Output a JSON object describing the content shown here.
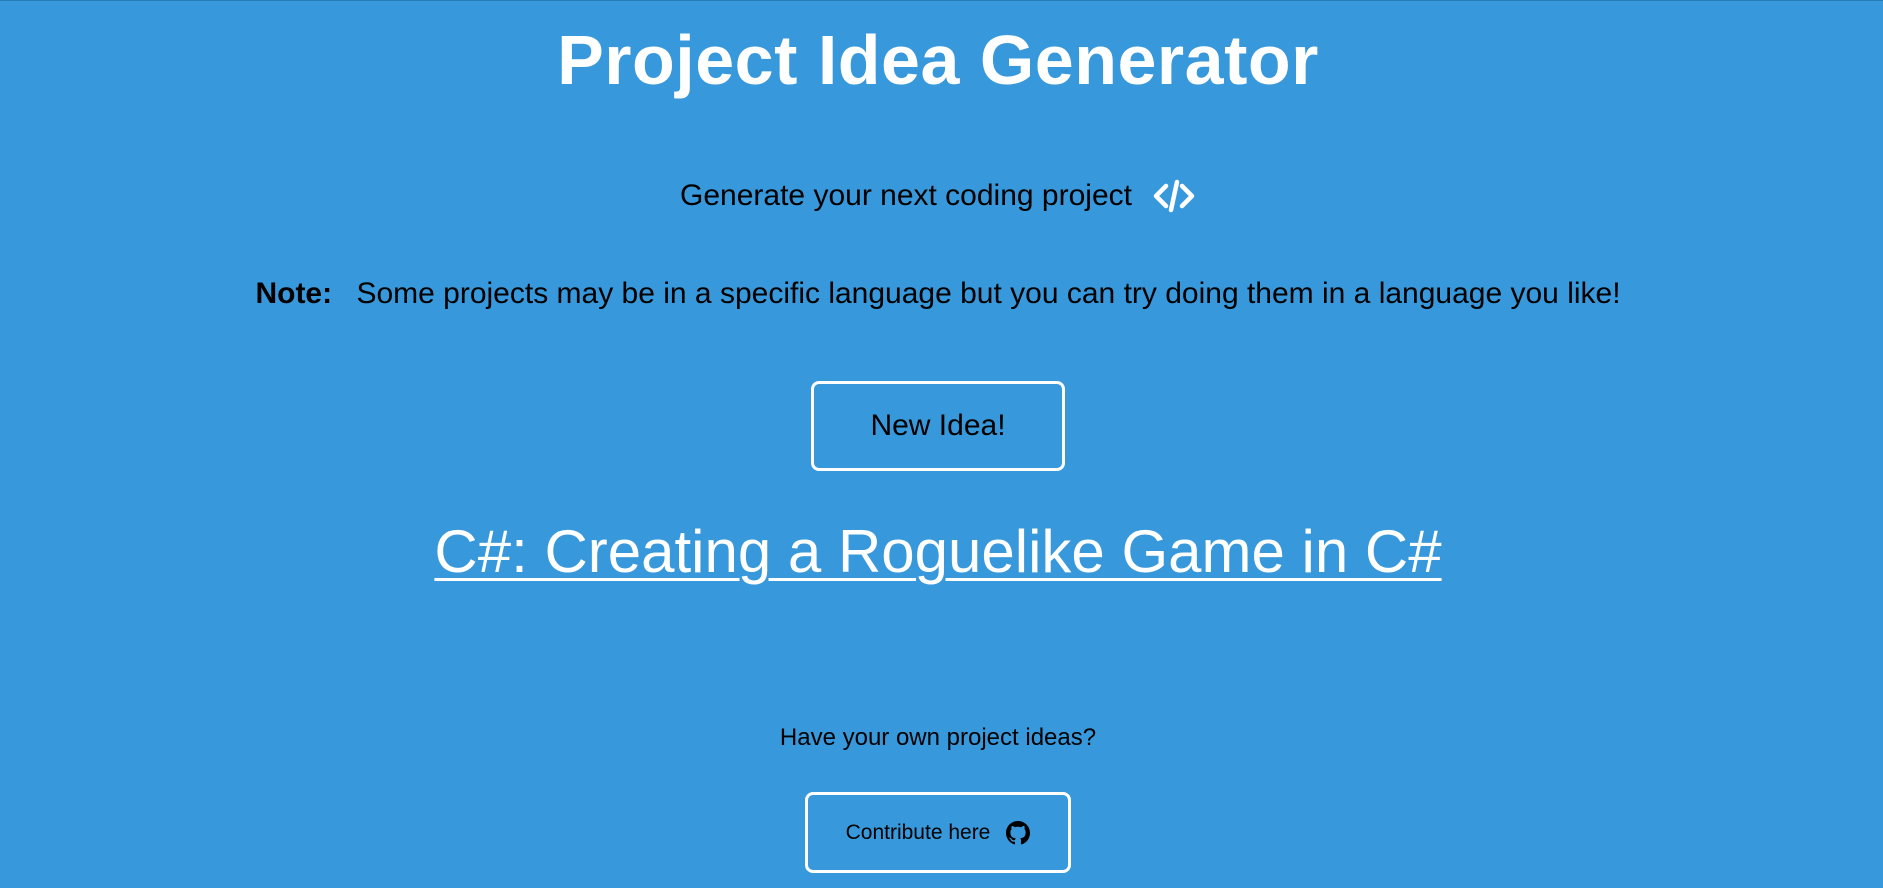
{
  "page": {
    "background_color": "#3798db",
    "accent_color": "#ffffff"
  },
  "header": {
    "title": "Project Idea Generator"
  },
  "subtitle": {
    "text": "Generate your next coding project",
    "icon": "code-icon"
  },
  "note": {
    "label": "Note:",
    "text": "Some projects may be in a specific language but you can try doing them in a language you like!"
  },
  "actions": {
    "new_idea_label": "New Idea!"
  },
  "idea": {
    "text": "C#: Creating a Roguelike Game in C#"
  },
  "footer": {
    "prompt": "Have your own project ideas?",
    "contribute_label": "Contribute here",
    "contribute_icon": "github-icon"
  }
}
